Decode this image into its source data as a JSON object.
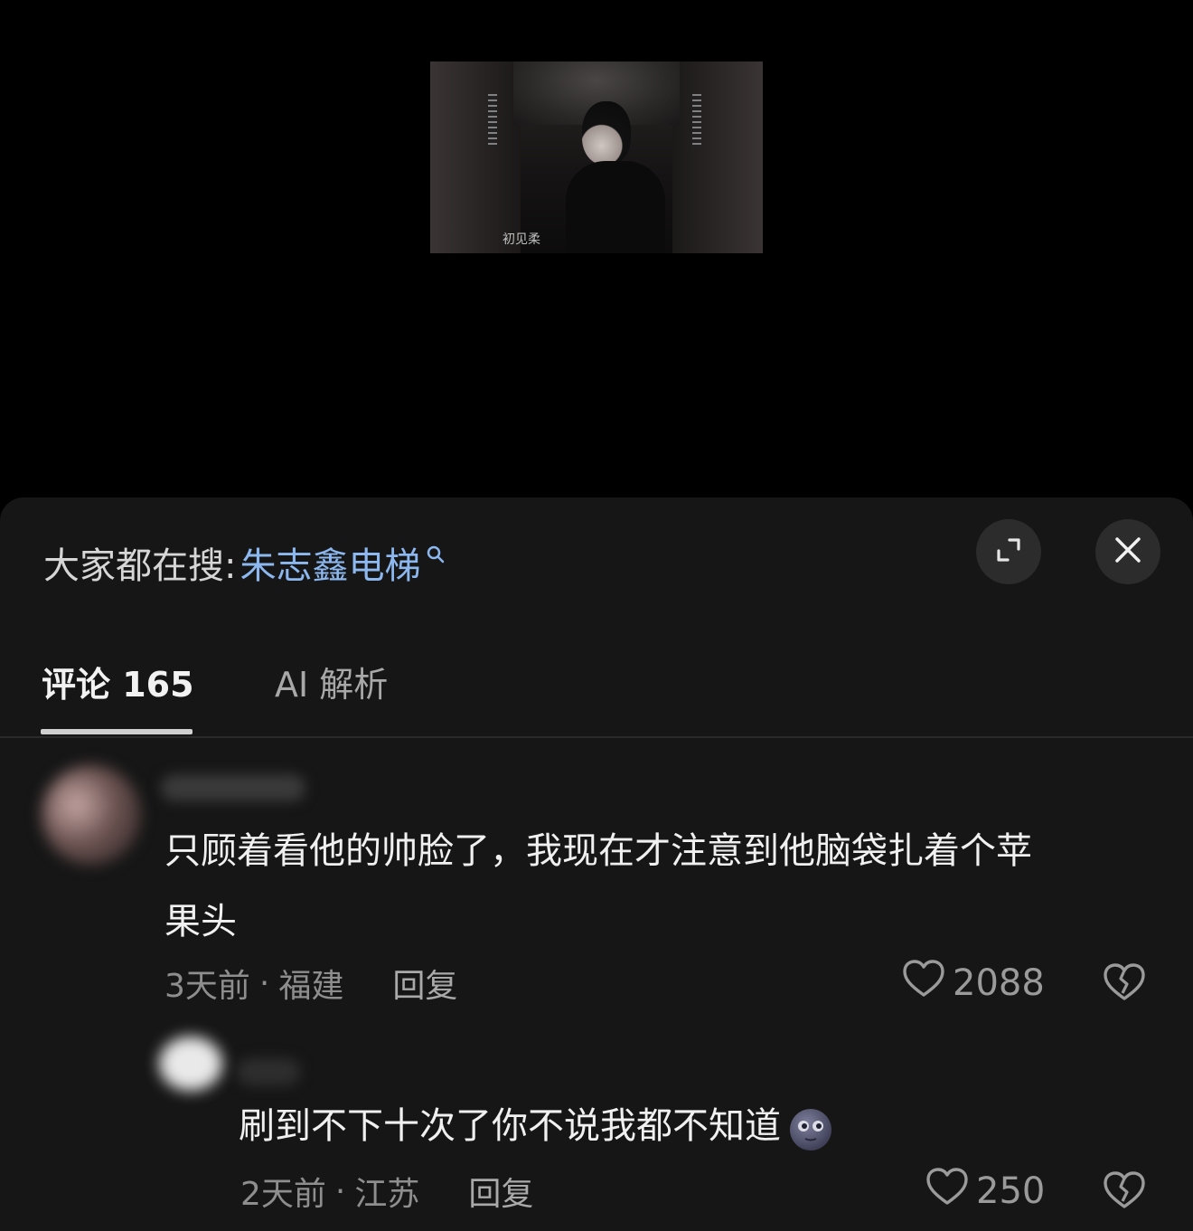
{
  "search": {
    "prefix": "大家都在搜:",
    "term": "朱志鑫电梯"
  },
  "tabs": [
    {
      "label": "评论 165",
      "active": true
    },
    {
      "label": "AI 解析",
      "active": false
    }
  ],
  "video": {
    "watermark": "初见柔"
  },
  "comments": [
    {
      "text_line1": "只顾着看他的帅脸了，我现在才注意到他脑袋扎着个苹",
      "text_line2": "果头",
      "time": "3天前",
      "location": "福建",
      "reply_label": "回复",
      "likes": "2088"
    },
    {
      "text": "刷到不下十次了你不说我都不知道",
      "emoji": "new-moon-face-emoji",
      "time": "2天前",
      "location": "江苏",
      "reply_label": "回复",
      "likes": "250"
    }
  ],
  "meta_separator": "·",
  "colors": {
    "accent_link": "#8cb8ef",
    "sheet_bg": "#161616",
    "button_bg": "#2c2c2c"
  }
}
